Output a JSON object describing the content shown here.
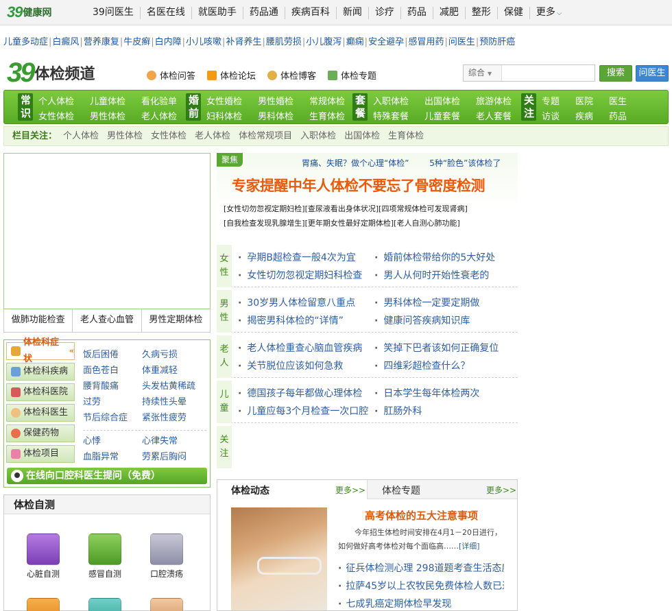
{
  "site": {
    "logo_number": "39",
    "logo_text": "健康网"
  },
  "topnav": [
    "39问医生",
    "名医在线",
    "就医助手",
    "药品通",
    "疾病百科",
    "新闻",
    "诊疗",
    "药品",
    "减肥",
    "整形",
    "保健"
  ],
  "topnav_more": "更多",
  "keywords": [
    "儿童多动症",
    "白癜风",
    "营养康复",
    "牛皮癣",
    "白内障",
    "小儿咳嗽",
    "补肾养生",
    "腰肌劳损",
    "小儿腹泻",
    "癫痫",
    "安全避孕",
    "感冒用药",
    "问医生",
    "预防肝癌"
  ],
  "channel": {
    "logo_number": "39",
    "logo_text": "体检频道"
  },
  "channel_links": [
    "体检问答",
    "体检论坛",
    "体检博客",
    "体检专题"
  ],
  "search": {
    "scope": "综合",
    "placeholder": "",
    "button": "搜索",
    "ask_button": "问医生"
  },
  "green_nav": [
    {
      "tag": "常识",
      "links": [
        "个人体检",
        "女性体检",
        "儿童体检",
        "男性体检",
        "看化验单",
        "老人体检"
      ]
    },
    {
      "tag": "婚前",
      "links": [
        "女性婚检",
        "妇科体检",
        "男性婚检",
        "男科体检",
        "常规体检",
        "生育体检"
      ]
    },
    {
      "tag": "套餐",
      "links": [
        "入职体检",
        "特殊套餐",
        "出国体检",
        "儿童套餐",
        "旅游体检",
        "老人套餐"
      ]
    },
    {
      "tag": "关注",
      "links": [
        "专题",
        "访谈",
        "医院",
        "疾病",
        "医生",
        "药品"
      ]
    }
  ],
  "focus_bar": {
    "label": "栏目关注：",
    "items": [
      "个人体检",
      "男性体检",
      "女性体检",
      "老人体检",
      "体检常规项目",
      "入职体检",
      "出国体检",
      "生育体检"
    ]
  },
  "image_tabs": [
    "做肺功能检查",
    "老人查心血管",
    "男性定期体检"
  ],
  "symptom_tabs": [
    "体检科症状",
    "体检科疾病",
    "体检科医院",
    "体检科医生",
    "保健药物",
    "体检项目"
  ],
  "symptoms_a": [
    [
      "饭后困倦",
      "久病亏损"
    ],
    [
      "面色苍白",
      "体重减轻"
    ],
    [
      "腰背酸痛",
      "头发枯黄稀疏"
    ],
    [
      "过劳",
      "持续性头晕"
    ],
    [
      "节后综合症",
      "紧张性疲劳"
    ]
  ],
  "symptoms_b": [
    [
      "心悸",
      "心律失常"
    ],
    [
      "血脂异常",
      "劳累后胸闷"
    ]
  ],
  "ask_banner": "在线向口腔科医生提问（免费）",
  "self_test": {
    "title": "体检自测",
    "items": [
      "心脏自测",
      "感冒自测",
      "口腔溃疡"
    ]
  },
  "focus": {
    "tag": "聚焦",
    "top_links": [
      "胃痛、失眠？做个心理“体检”",
      "5种“脸色”该体检了"
    ],
    "headline": "专家提醒中年人体检不要忘了骨密度检测",
    "sublinks_1": "[女性切勿忽视定期妇检][查尿液看出身体状况][四项常规体检可发现肾病]",
    "sublinks_2": "[自我检查发现乳腺增生][更年期女性最好定期体检][老人自测心肺功能]"
  },
  "categories": [
    {
      "tag": "女性",
      "links": [
        "孕期B超检查一般4次为宜",
        "婚前体检带给你的5大好处",
        "女性切勿忽视定期妇科检查",
        "男人从何时开始性衰老的"
      ]
    },
    {
      "tag": "男性",
      "links": [
        "30岁男人体检留意八重点",
        "男科体检一定要定期做",
        "揭密男科体检的“详情”",
        "健康问答疾病知识库"
      ]
    },
    {
      "tag": "老人",
      "links": [
        "老人体检重查心脑血管疾病",
        "笑掉下巴者该如何正确复位",
        "关节脱位应该如何急救",
        "四维彩超检查什么？"
      ]
    },
    {
      "tag": "儿童",
      "links": [
        "德国孩子每年都做心理体检",
        "日本学生每年体检两次",
        "儿童应每3个月检查一次口腔",
        "肛肠外科"
      ]
    },
    {
      "tag": "关注",
      "links": []
    }
  ],
  "news": {
    "tab1": "体检动态",
    "tab2": "体检专题",
    "more": "更多>>",
    "title": "高考体检的五大注意事项",
    "summary": "今年招生体检时间安排在4月1－20日进行，如何做好高考体检对每个面临高……",
    "summary_more": "[详细]",
    "links": [
      "征兵体检测心理 298道题考查生活态度",
      "拉萨45岁以上农牧民免费体检人数已过",
      "七成乳癌定期体检早发现"
    ]
  },
  "colors": {
    "brand_green": "#58ab25",
    "accent_orange": "#ea5a0a",
    "link_blue": "#2e5ea5",
    "ask_blue": "#3b86d5"
  }
}
